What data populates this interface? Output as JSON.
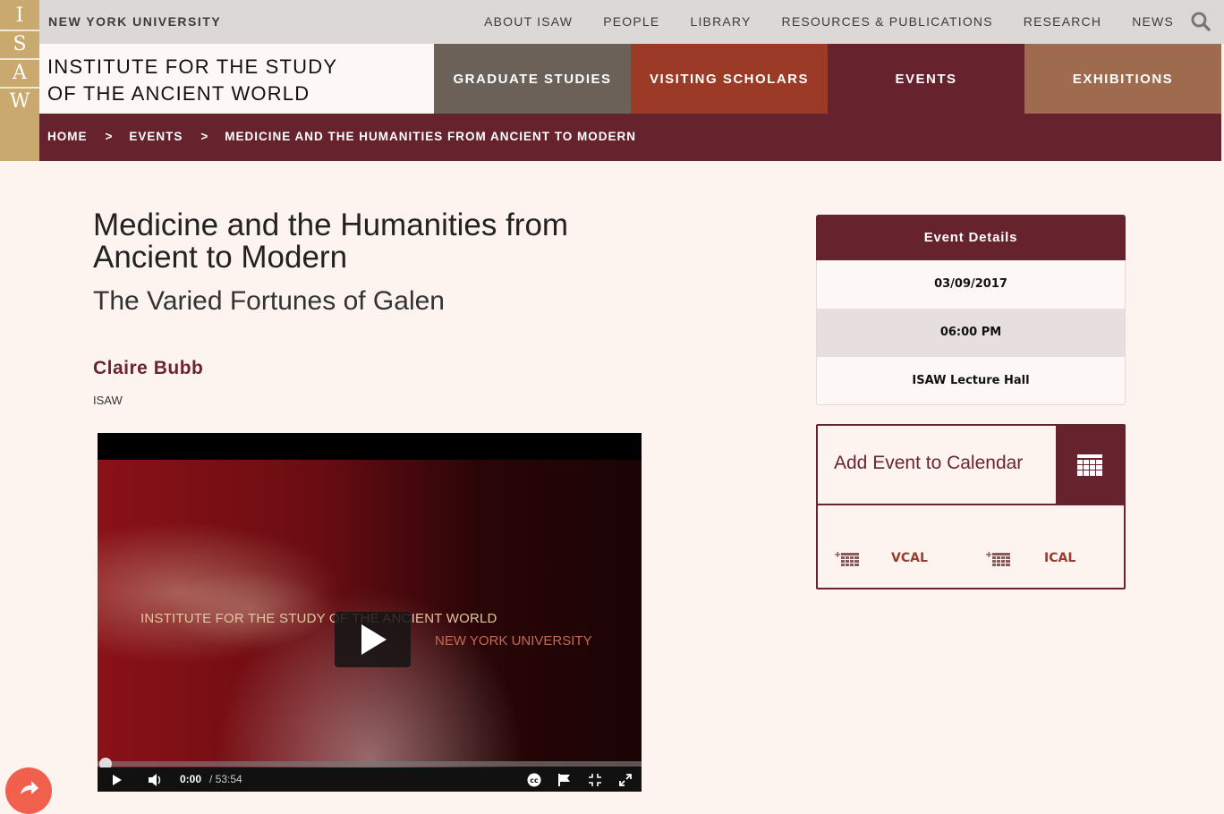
{
  "logo": {
    "letters": [
      "I",
      "S",
      "A",
      "W"
    ],
    "color": "#c9a96e"
  },
  "topbar": {
    "university": "NEW YORK UNIVERSITY",
    "nav": [
      "ABOUT ISAW",
      "PEOPLE",
      "LIBRARY",
      "RESOURCES & PUBLICATIONS",
      "RESEARCH",
      "NEWS"
    ],
    "search_icon": "search-icon"
  },
  "brand": {
    "line1": "INSTITUTE FOR THE STUDY",
    "line2": "OF THE ANCIENT WORLD"
  },
  "mainnav": [
    {
      "label": "GRADUATE STUDIES",
      "color": "#6b6158"
    },
    {
      "label": "VISITING SCHOLARS",
      "color": "#9a3a27"
    },
    {
      "label": "EVENTS",
      "color": "#66232d"
    },
    {
      "label": "EXHIBITIONS",
      "color": "#9e6b4f"
    }
  ],
  "breadcrumb": {
    "items": [
      "HOME",
      "EVENTS",
      "MEDICINE AND THE HUMANITIES FROM ANCIENT TO MODERN"
    ],
    "separator": ">"
  },
  "event": {
    "title": "Medicine and the Humanities from Ancient to Modern",
    "subtitle": "The Varied Fortunes of Galen",
    "speaker": "Claire Bubb",
    "affiliation": "ISAW"
  },
  "video": {
    "overlay_line1": "INSTITUTE FOR THE STUDY OF THE ANCIENT WORLD",
    "overlay_line2": "NEW YORK UNIVERSITY",
    "current_time": "0:00",
    "duration": "/ 53:54",
    "progress": 0,
    "cc_label": "cc"
  },
  "event_details": {
    "heading": "Event Details",
    "date": "03/09/2017",
    "time": "06:00 PM",
    "location": "ISAW Lecture Hall"
  },
  "calendar": {
    "title": "Add Event to Calendar",
    "links": [
      "VCAL",
      "ICAL"
    ]
  },
  "colors": {
    "accent": "#66232d",
    "background": "#fdf4f0",
    "share": "#f1604c"
  }
}
